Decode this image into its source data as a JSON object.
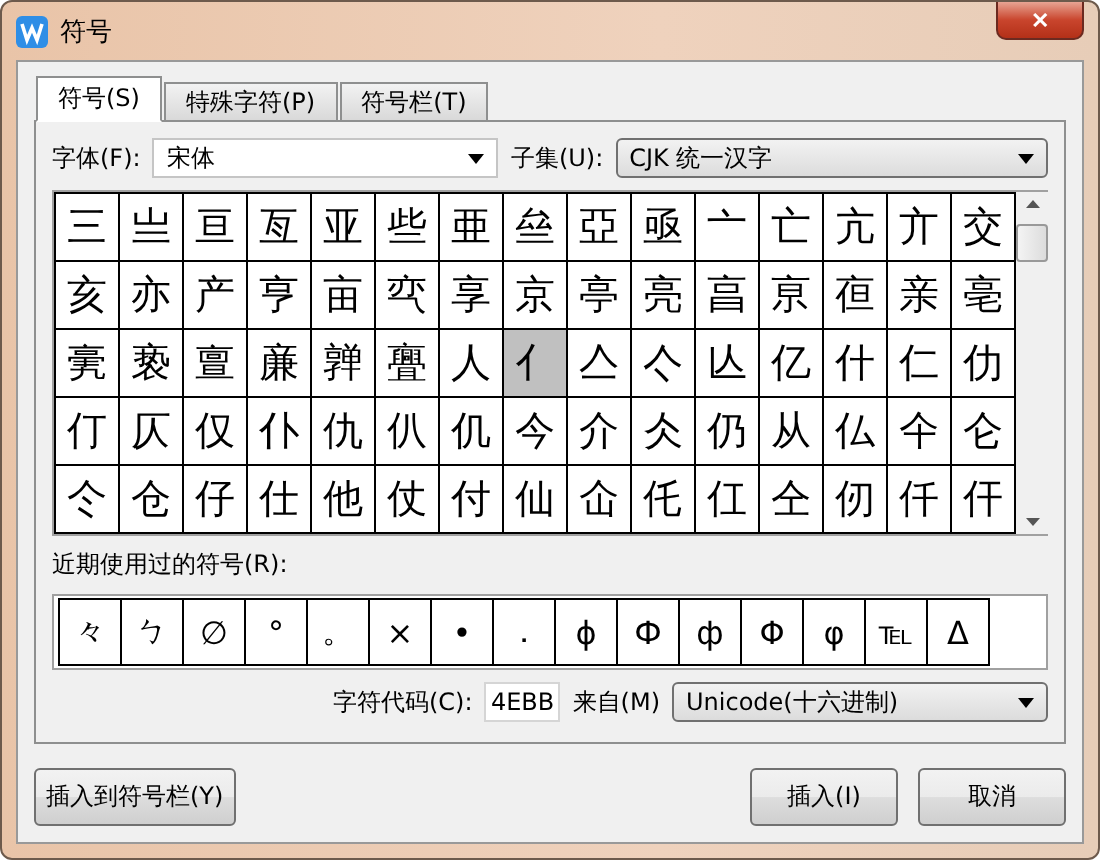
{
  "window": {
    "title": "符号",
    "close": "✕"
  },
  "tabs": [
    {
      "label": "符号(S)",
      "selected": true
    },
    {
      "label": "特殊字符(P)",
      "selected": false
    },
    {
      "label": "符号栏(T)",
      "selected": false
    }
  ],
  "font": {
    "label": "字体(F):",
    "value": "宋体"
  },
  "subset": {
    "label": "子集(U):",
    "value": "CJK 统一汉字"
  },
  "grid": [
    [
      {
        "char": "三",
        "selected": false
      },
      {
        "char": "亗",
        "selected": false
      },
      {
        "char": "亘",
        "selected": false
      },
      {
        "char": "亙",
        "selected": false
      },
      {
        "char": "亚",
        "selected": false
      },
      {
        "char": "些",
        "selected": false
      },
      {
        "char": "亜",
        "selected": false
      },
      {
        "char": "亝",
        "selected": false
      },
      {
        "char": "亞",
        "selected": false
      },
      {
        "char": "亟",
        "selected": false
      },
      {
        "char": "亠",
        "selected": false
      },
      {
        "char": "亡",
        "selected": false
      },
      {
        "char": "亢",
        "selected": false
      },
      {
        "char": "亣",
        "selected": false
      },
      {
        "char": "交",
        "selected": false
      }
    ],
    [
      {
        "char": "亥",
        "selected": false
      },
      {
        "char": "亦",
        "selected": false
      },
      {
        "char": "产",
        "selected": false
      },
      {
        "char": "亨",
        "selected": false
      },
      {
        "char": "亩",
        "selected": false
      },
      {
        "char": "亪",
        "selected": false
      },
      {
        "char": "享",
        "selected": false
      },
      {
        "char": "京",
        "selected": false
      },
      {
        "char": "亭",
        "selected": false
      },
      {
        "char": "亮",
        "selected": false
      },
      {
        "char": "亯",
        "selected": false
      },
      {
        "char": "亰",
        "selected": false
      },
      {
        "char": "亱",
        "selected": false
      },
      {
        "char": "亲",
        "selected": false
      },
      {
        "char": "亳",
        "selected": false
      }
    ],
    [
      {
        "char": "亴",
        "selected": false
      },
      {
        "char": "亵",
        "selected": false
      },
      {
        "char": "亶",
        "selected": false
      },
      {
        "char": "亷",
        "selected": false
      },
      {
        "char": "亸",
        "selected": false
      },
      {
        "char": "亹",
        "selected": false
      },
      {
        "char": "人",
        "selected": false
      },
      {
        "char": "亻",
        "selected": true
      },
      {
        "char": "亼",
        "selected": false
      },
      {
        "char": "亽",
        "selected": false
      },
      {
        "char": "亾",
        "selected": false
      },
      {
        "char": "亿",
        "selected": false
      },
      {
        "char": "什",
        "selected": false
      },
      {
        "char": "仁",
        "selected": false
      },
      {
        "char": "仂",
        "selected": false
      }
    ],
    [
      {
        "char": "仃",
        "selected": false
      },
      {
        "char": "仄",
        "selected": false
      },
      {
        "char": "仅",
        "selected": false
      },
      {
        "char": "仆",
        "selected": false
      },
      {
        "char": "仇",
        "selected": false
      },
      {
        "char": "仈",
        "selected": false
      },
      {
        "char": "仉",
        "selected": false
      },
      {
        "char": "今",
        "selected": false
      },
      {
        "char": "介",
        "selected": false
      },
      {
        "char": "仌",
        "selected": false
      },
      {
        "char": "仍",
        "selected": false
      },
      {
        "char": "从",
        "selected": false
      },
      {
        "char": "仏",
        "selected": false
      },
      {
        "char": "仐",
        "selected": false
      },
      {
        "char": "仑",
        "selected": false
      }
    ],
    [
      {
        "char": "仒",
        "selected": false
      },
      {
        "char": "仓",
        "selected": false
      },
      {
        "char": "仔",
        "selected": false
      },
      {
        "char": "仕",
        "selected": false
      },
      {
        "char": "他",
        "selected": false
      },
      {
        "char": "仗",
        "selected": false
      },
      {
        "char": "付",
        "selected": false
      },
      {
        "char": "仙",
        "selected": false
      },
      {
        "char": "仚",
        "selected": false
      },
      {
        "char": "仛",
        "selected": false
      },
      {
        "char": "仜",
        "selected": false
      },
      {
        "char": "仝",
        "selected": false
      },
      {
        "char": "仞",
        "selected": false
      },
      {
        "char": "仟",
        "selected": false
      },
      {
        "char": "仠",
        "selected": false
      }
    ]
  ],
  "recent": {
    "label": "近期使用过的符号(R):",
    "symbols": [
      "々",
      "ㄅ",
      "∅",
      "°",
      "。",
      "×",
      "•",
      "．",
      "ɸ",
      "Ф",
      "ф",
      "Φ",
      "φ",
      "℡",
      "Δ"
    ]
  },
  "char_code": {
    "label": "字符代码(C):",
    "value": "4EBB"
  },
  "from": {
    "label": "来自(M)",
    "value": "Unicode(十六进制)"
  },
  "buttons": [
    {
      "label": "插入到符号栏(Y)",
      "kind": "left"
    },
    {
      "label": "插入(I)",
      "kind": "right"
    },
    {
      "label": "取消",
      "kind": "right"
    }
  ]
}
